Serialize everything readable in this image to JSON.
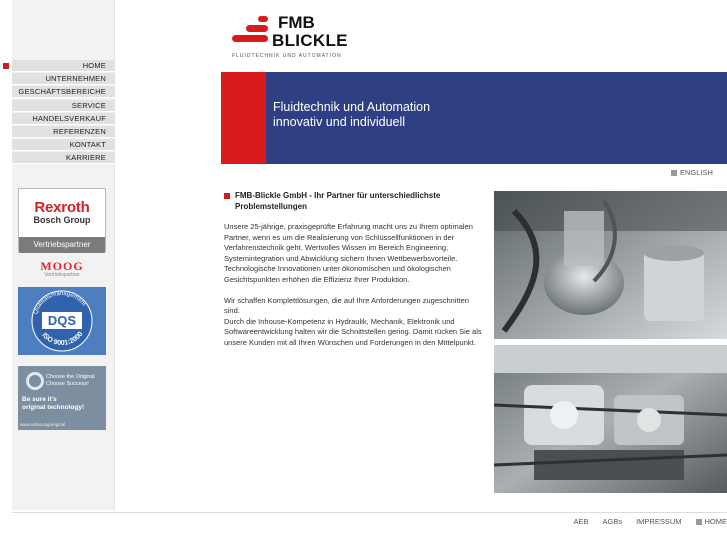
{
  "nav": {
    "items": [
      {
        "label": "HOME"
      },
      {
        "label": "UNTERNEHMEN"
      },
      {
        "label": "GESCHÄFTSBEREICHE"
      },
      {
        "label": "SERVICE"
      },
      {
        "label": "HANDELSVERKAUF"
      },
      {
        "label": "REFERENZEN"
      },
      {
        "label": "KONTAKT"
      },
      {
        "label": "KARRIERE"
      }
    ],
    "active_index": 0,
    "accent_color": "#cc1f1f"
  },
  "logo": {
    "line1": "FMB",
    "line2": "BLICKLE",
    "tagline": "FLUIDTECHNIK UND AUTOMATION"
  },
  "banner": {
    "title_line1": "Fluidtechnik und Automation",
    "title_line2": "innovativ und individuell",
    "background_color": "#2e3f83",
    "accent_color": "#d81c1c"
  },
  "language_link": "ENGLISH",
  "partners": {
    "rexroth": {
      "brand": "Rexroth",
      "group": "Bosch Group",
      "caption": "Vertriebspartner"
    },
    "moog": {
      "brand": "MOOG",
      "caption": "Vertriebspartner"
    },
    "dqs": {
      "top": "Qualitätsmanagement",
      "center": "DQS",
      "bottom": "ISO 9001:2000"
    },
    "original": {
      "line1": "Choose the Original",
      "line2": "Choose Success!",
      "line3": "Be sure it's",
      "line4": "original technology!",
      "url": "www.vdma.org/original"
    }
  },
  "content": {
    "headline": "FMB-Blickle GmbH - Ihr Partner für unterschiedlichste Problemstellungen",
    "paragraph1": "Unsere 25-jährige, praxisgeprüfte Erfahrung macht uns zu Ihrem optimalen Partner, wenn es um die Realisierung von Schlüssellfunktionen in der Verfahrenstechnik geht. Wertvolles Wissen im Bereich Engineering, Systemintegration und Abwicklung sichern Ihnen Wettbewerbsvorteile.",
    "paragraph1b": "Technologische Innovationen unter ökonomischen und ökologischen Gesichtspunkten erhöhen die Effizienz Ihrer Produktion.",
    "paragraph2": "Wir schaffen Komplettlösungen, die auf Ihre Anforderungen zugeschnitten sind.",
    "paragraph2b": "Durch die Inhouse-Kompetenz in Hydraulik, Mechanik, Elektronik und Softwareentwicklung halten wir die Schnittstellen gering. Damit rücken Sie als unsere Kunden mit all Ihren Wünschen und Forderungen in den Mittelpunkt."
  },
  "footer": {
    "links": [
      "AEB",
      "AGBs",
      "IMPRESSUM",
      "HOME"
    ]
  }
}
